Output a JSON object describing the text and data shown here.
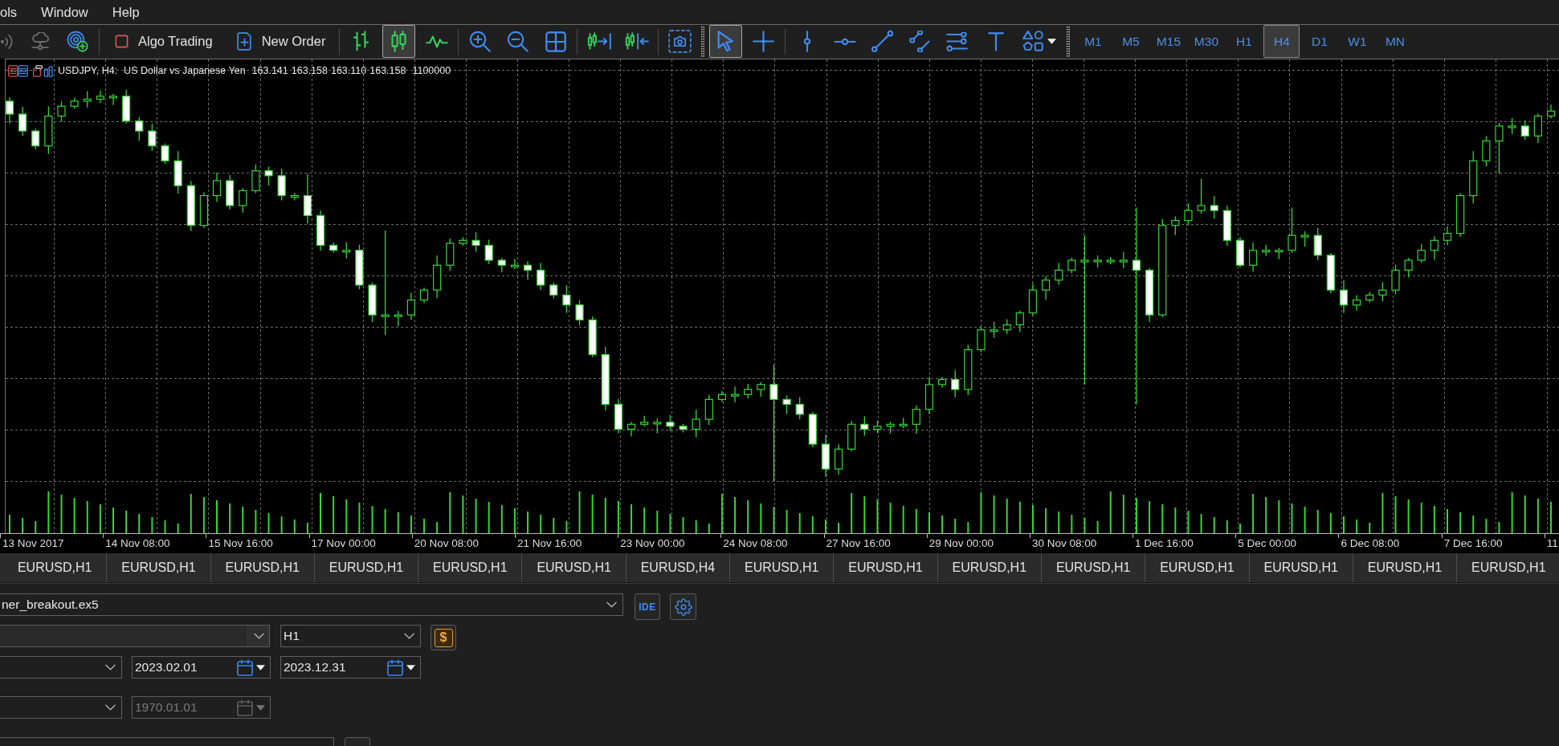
{
  "menu_bar": [
    {
      "label": "ols"
    },
    {
      "label": "Window"
    },
    {
      "label": "Help"
    }
  ],
  "toolbar": {
    "connection": [
      {
        "disabled": true
      },
      {
        "disabled": true
      },
      {
        "disabled": false
      }
    ],
    "algo_trading": {
      "label": "Algo Trading",
      "on": false
    },
    "new_order": {
      "label": "New Order"
    },
    "chart_types": [
      {
        "selected": false
      },
      {
        "selected": true
      },
      {
        "selected": false
      }
    ],
    "cursor_tools": [
      {
        "selected": true
      },
      {
        "selected": false
      }
    ],
    "timeframes": [
      {
        "label": "M1",
        "selected": false
      },
      {
        "label": "M5",
        "selected": false
      },
      {
        "label": "M15",
        "selected": false
      },
      {
        "label": "M30",
        "selected": false
      },
      {
        "label": "H1",
        "selected": false
      },
      {
        "label": "H4",
        "selected": true
      },
      {
        "label": "D1",
        "selected": false
      },
      {
        "label": "W1",
        "selected": false
      },
      {
        "label": "MN",
        "selected": false
      }
    ]
  },
  "chart": {
    "symbol": "USDJPY, H4:",
    "description": "US Dollar vs Japanese Yen",
    "quotes": [
      "163.141",
      "163.158",
      "163.110",
      "163.158"
    ],
    "volume": "1100000",
    "time_labels": [
      "13 Nov 2017",
      "14 Nov 08:00",
      "15 Nov 16:00",
      "17 Nov 00:00",
      "20 Nov 08:00",
      "21 Nov 16:00",
      "23 Nov 00:00",
      "24 Nov 08:00",
      "27 Nov 16:00",
      "29 Nov 00:00",
      "30 Nov 08:00",
      "1 Dec 16:00",
      "5 Dec 00:00",
      "6 Dec 08:00",
      "7 Dec 16:00",
      "11"
    ]
  },
  "chart_tabs": [
    {
      "label": "EURUSD,H1",
      "selected": false
    },
    {
      "label": "EURUSD,H1",
      "selected": false
    },
    {
      "label": "EURUSD,H1",
      "selected": false
    },
    {
      "label": "EURUSD,H1",
      "selected": false
    },
    {
      "label": "EURUSD,H1",
      "selected": false
    },
    {
      "label": "EURUSD,H1",
      "selected": false
    },
    {
      "label": "EURUSD,H4",
      "selected": false
    },
    {
      "label": "EURUSD,H1",
      "selected": false
    },
    {
      "label": "EURUSD,H1",
      "selected": false
    },
    {
      "label": "EURUSD,H1",
      "selected": false
    },
    {
      "label": "EURUSD,H1",
      "selected": false
    },
    {
      "label": "EURUSD,H1",
      "selected": false
    },
    {
      "label": "EURUSD,H1",
      "selected": false
    },
    {
      "label": "EURUSD,H1",
      "selected": false
    },
    {
      "label": "EURUSD,H1",
      "selected": false
    }
  ],
  "tester": {
    "expert": "ner_breakout.ex5",
    "ide_button": "IDE",
    "timeframe": "H1",
    "currency_button": "$",
    "date_from": {
      "value": "2023.02.01",
      "disabled": false
    },
    "date_to": {
      "value": "2023.12.31",
      "disabled": false
    },
    "forward_date": {
      "value": "1970.01.01",
      "disabled": true
    }
  }
}
